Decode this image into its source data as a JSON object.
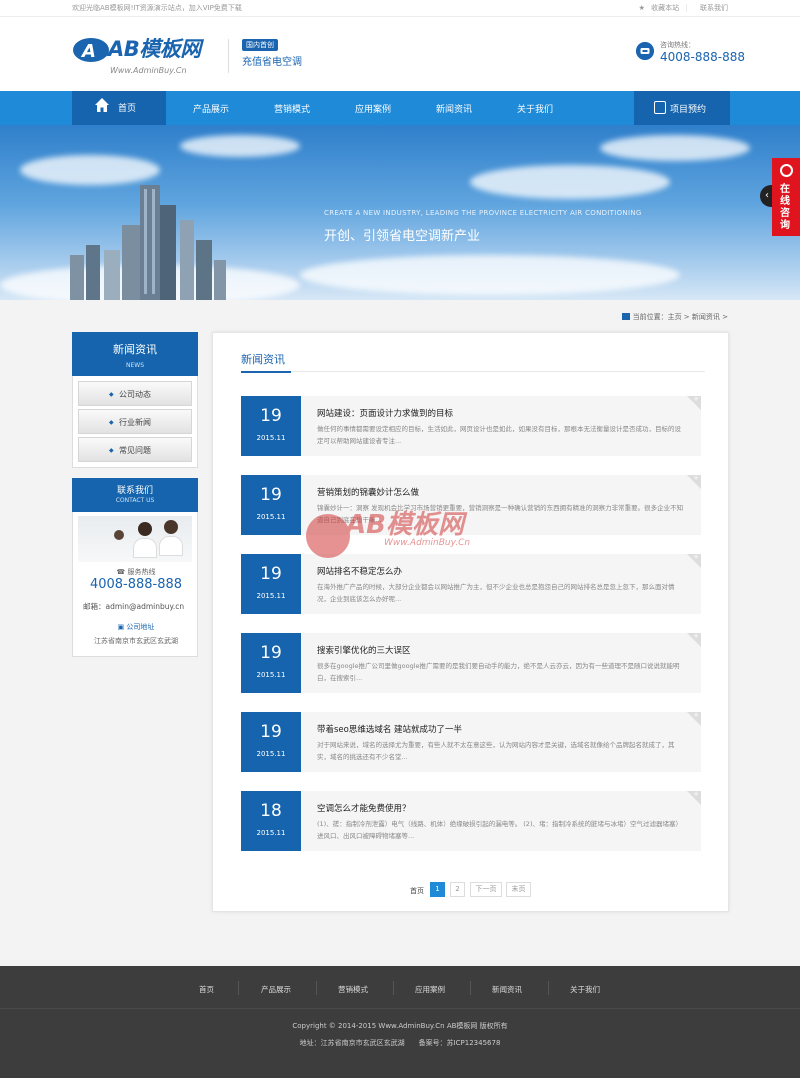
{
  "topbar": {
    "welcome": "欢迎光临AB模板网!IT资源演示站点，加入VIP免费下载",
    "bookmark": "收藏本站",
    "contact": "联系我们"
  },
  "header": {
    "logo_text": "AB模板网",
    "logo_url": "Www.AdminBuy.Cn",
    "tag": "国内首创",
    "tagline": "充值省电空调",
    "hotline_label": "咨询热线：",
    "hotline_number": "4008-888-888"
  },
  "nav": {
    "home": "首页",
    "items": [
      "产品展示",
      "营销模式",
      "应用案例",
      "新闻资讯",
      "关于我们"
    ],
    "booking": "项目预约"
  },
  "banner": {
    "sub": "CREATE A NEW INDUSTRY, LEADING THE PROVINCE ELECTRICITY AIR CONDITIONING",
    "main": "开创、引领省电空调新产业"
  },
  "consult": {
    "label": "在线咨询"
  },
  "breadcrumb": {
    "prefix": "当前位置：",
    "home": "主页",
    "current": "新闻资讯"
  },
  "sidebar": {
    "title": "新闻资讯",
    "subtitle": "NEWS",
    "items": [
      "公司动态",
      "行业新闻",
      "常见问题"
    ],
    "contact_title": "联系我们",
    "contact_subtitle": "CONTACT US",
    "service_label": "服务热线",
    "service_number": "4008-888-888",
    "email": "邮箱：admin@adminbuy.cn",
    "address_label": "公司地址",
    "address": "江苏省南京市玄武区玄武湖"
  },
  "content": {
    "title": "新闻资讯",
    "news": [
      {
        "day": "19",
        "month": "2015.11",
        "title": "网站建设：页面设计力求做到的目标",
        "desc": "做任何的事情都需要设定相应的目标，生活如此，网页设计也是如此，如果没有目标，那根本无法衡量设计是否成功，目标的设定可以帮助网站建设者专注..."
      },
      {
        "day": "19",
        "month": "2015.11",
        "title": "营销策划的锦囊妙计怎么做",
        "desc": "锦囊妙计一：洞察 发现机会比学习市场营销更重要，营销洞察是一种确认营销的东西拥有精准的洞察力非常重要。很多企业不知道自己到底在想干嘛..."
      },
      {
        "day": "19",
        "month": "2015.11",
        "title": "网站排名不稳定怎么办",
        "desc": "在海外推广产品的时候，大部分企业都会以网站推广为主，但不少企业也总是抱怨自己的网站排名总是忽上忽下，那么面对情况，企业到底该怎么办好呢..."
      },
      {
        "day": "19",
        "month": "2015.11",
        "title": "搜索引擎优化的三大误区",
        "desc": "很多在google推广公司里做google推广需要的是我们要自动手的能力，绝不是人云亦云，因为有一些道理不是随口说说就能明白，在搜索引..."
      },
      {
        "day": "19",
        "month": "2015.11",
        "title": "带着seo思维选域名 建站就成功了一半",
        "desc": "对于网站来说，域名的选择尤为重要，有些人就不太在意这些，认为网站内容才是关键，选域名就像给个品牌起名就成了，其实，域名的挑选还有不少名堂..."
      },
      {
        "day": "18",
        "month": "2015.11",
        "title": "空调怎么才能免费使用？",
        "desc": "(1)、搓：指制冷剂泄露）电气（线路、机体）绝缘破损引起的漏电等。 (2)、堵：指制冷系统的脏堵与冰堵）空气过滤器堵塞）进风口、出风口被障碍物堵塞等..."
      }
    ],
    "pager": {
      "first": "首页",
      "pages": [
        "1",
        "2"
      ],
      "next": "下一页",
      "last": "末页"
    }
  },
  "watermark": {
    "text": "AB模板网",
    "url": "Www.AdminBuy.Cn"
  },
  "footer": {
    "nav": [
      "首页",
      "产品展示",
      "营销模式",
      "应用案例",
      "新闻资讯",
      "关于我们"
    ],
    "copyright": "Copyright © 2014-2015 Www.AdminBuy.Cn AB模板网 版权所有",
    "address": "地址：江苏省南京市玄武区玄武湖　　备案号：苏ICP12345678"
  },
  "colors": {
    "primary": "#1564ad",
    "nav": "#1e8ad8",
    "accent_red": "#e0141e",
    "footer": "#3d3d3d"
  }
}
